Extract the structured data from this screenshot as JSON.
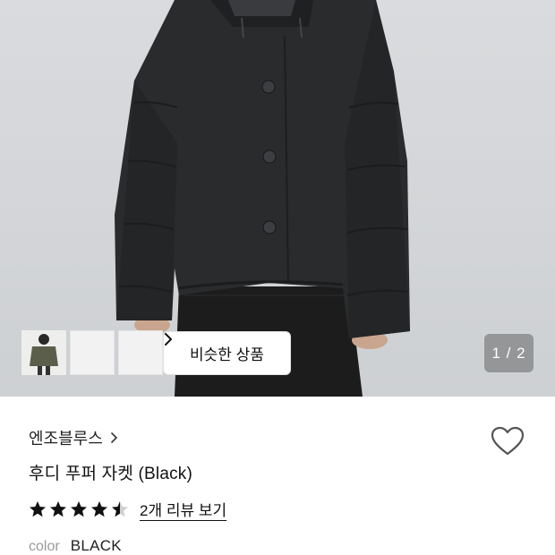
{
  "gallery": {
    "thumbnails": [
      {
        "icon": "brown-jacket-model-image"
      },
      {
        "icon": "black-jacket-model-image"
      },
      {
        "icon": "khaki-jacket-model-image"
      }
    ],
    "similar_label": "비슷한 상품",
    "counter": "1 / 2",
    "counter_current": 1,
    "counter_total": 2
  },
  "product": {
    "brand": "엔조블루스",
    "name": "후디 푸퍼 자켓 (Black)",
    "rating": 4.5,
    "review_link": "2개 리뷰 보기",
    "color_label": "color",
    "color_value": "BLACK"
  },
  "colors": {
    "background": "#d6d8db",
    "jacket": "#2a2b2d",
    "star": "#111111",
    "heart_stroke": "#555555"
  }
}
